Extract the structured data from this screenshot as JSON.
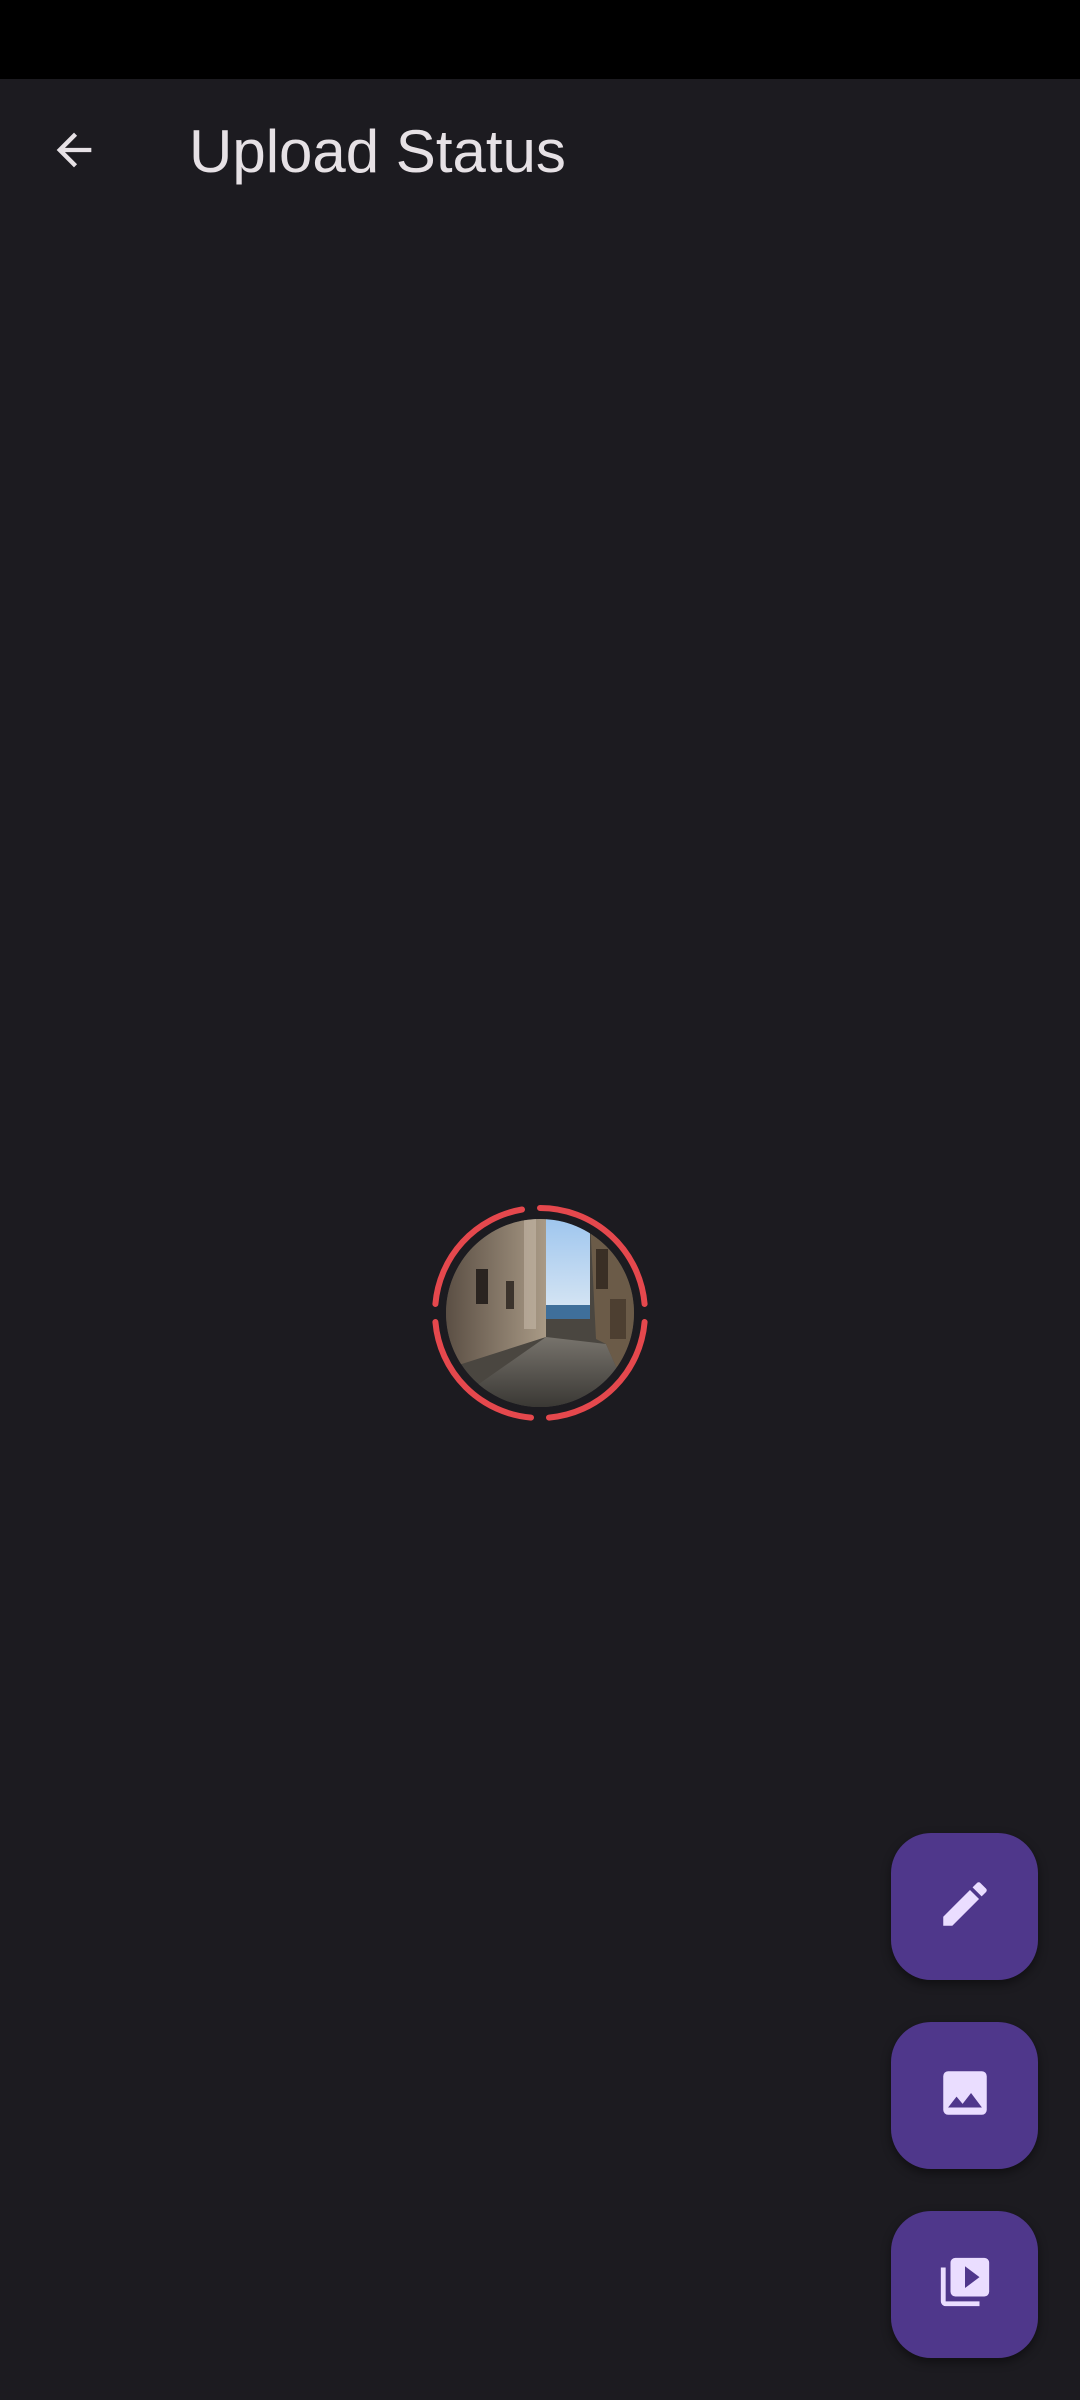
{
  "app_bar": {
    "title": "Upload Status",
    "back_icon": "arrow-back-icon"
  },
  "status": {
    "segments": 3,
    "ring_color": "#e5484d",
    "thumbnail": "alley-photo"
  },
  "fabs": [
    {
      "icon": "pencil-icon"
    },
    {
      "icon": "image-icon"
    },
    {
      "icon": "video-library-icon"
    }
  ],
  "colors": {
    "background": "#1c1b20",
    "status_bar": "#000000",
    "title_text": "#e6e1e5",
    "fab_background": "#4f378b",
    "fab_icon": "#eaddff",
    "ring": "#e5484d"
  }
}
